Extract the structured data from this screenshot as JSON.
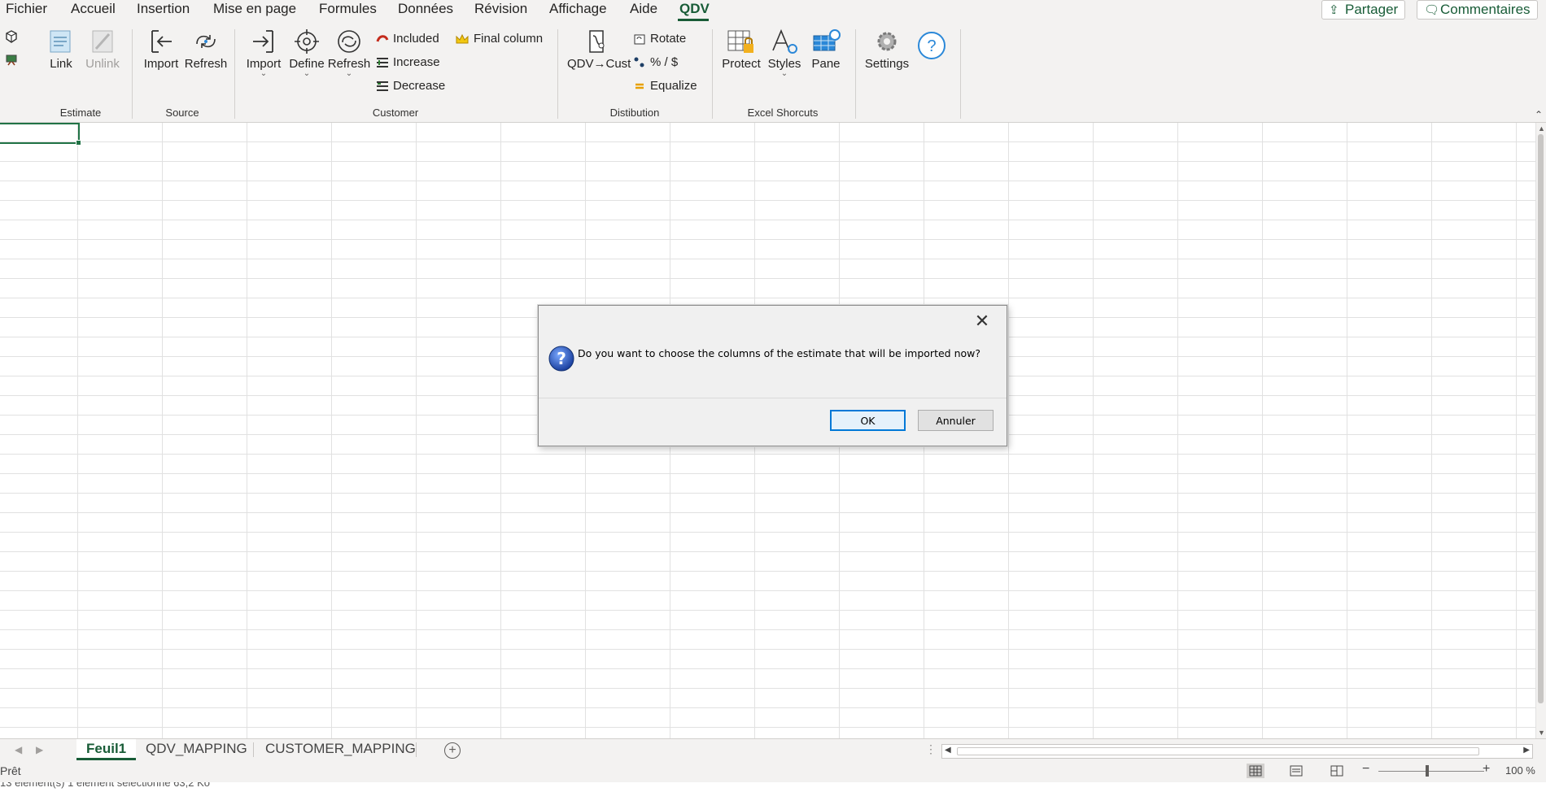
{
  "menu": {
    "items": [
      "Fichier",
      "Accueil",
      "Insertion",
      "Mise en page",
      "Formules",
      "Données",
      "Révision",
      "Affichage",
      "Aide",
      "QDV"
    ],
    "active": "QDV",
    "share_label": "Partager",
    "comments_label": "Commentaires"
  },
  "ribbon": {
    "estimate": {
      "group": "Estimate",
      "link": "Link",
      "unlink": "Unlink"
    },
    "source": {
      "group": "Source",
      "import": "Import",
      "refresh": "Refresh"
    },
    "customer": {
      "group": "Customer",
      "import": "Import",
      "define": "Define",
      "refresh": "Refresh",
      "included": "Included",
      "increase": "Increase",
      "decrease": "Decrease",
      "final_column": "Final column"
    },
    "distribution": {
      "group": "Distibution",
      "qdv_cust": "QDV→Cust",
      "rotate": "Rotate",
      "percent": "% / $",
      "equalize": "Equalize"
    },
    "excel": {
      "group": "Excel Shorcuts",
      "protect": "Protect",
      "styles": "Styles",
      "pane": "Pane"
    },
    "settings": "Settings"
  },
  "sheets": {
    "tabs": [
      "Feuil1",
      "QDV_MAPPING",
      "CUSTOMER_MAPPING"
    ],
    "active": "Feuil1"
  },
  "status": {
    "ready": "Prêt",
    "zoom": "100 %",
    "explorer_text": "13 élément(s)     1 élément sélectionné  63,2 Ko"
  },
  "dialog": {
    "message": "Do you want to choose the columns of the estimate that will be imported now?",
    "ok": "OK",
    "cancel": "Annuler"
  },
  "colors": {
    "accent": "#185c37",
    "selection": "#217346",
    "dialog_ok_border": "#0078d7"
  }
}
